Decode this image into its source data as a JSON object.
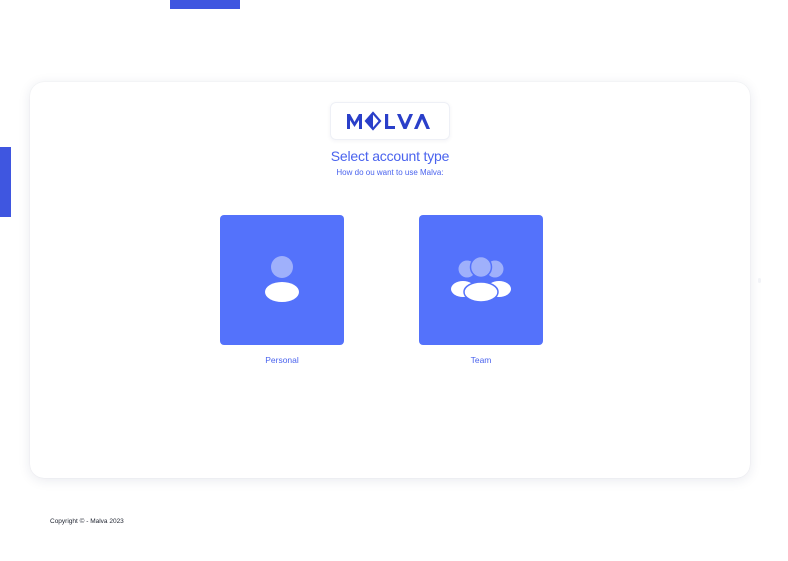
{
  "brand": {
    "logo_text": "MALVA",
    "accent_color": "#4a63ee",
    "tile_color": "#5472fb",
    "decor_color": "#3f56e0"
  },
  "heading": {
    "title": "Select account type",
    "subtitle": "How do ou want to use Malva:"
  },
  "options": [
    {
      "label": "Personal",
      "icon": "user-icon"
    },
    {
      "label": "Team",
      "icon": "users-group-icon"
    }
  ],
  "footer": {
    "copyright": "Copyright © - Malva 2023"
  }
}
